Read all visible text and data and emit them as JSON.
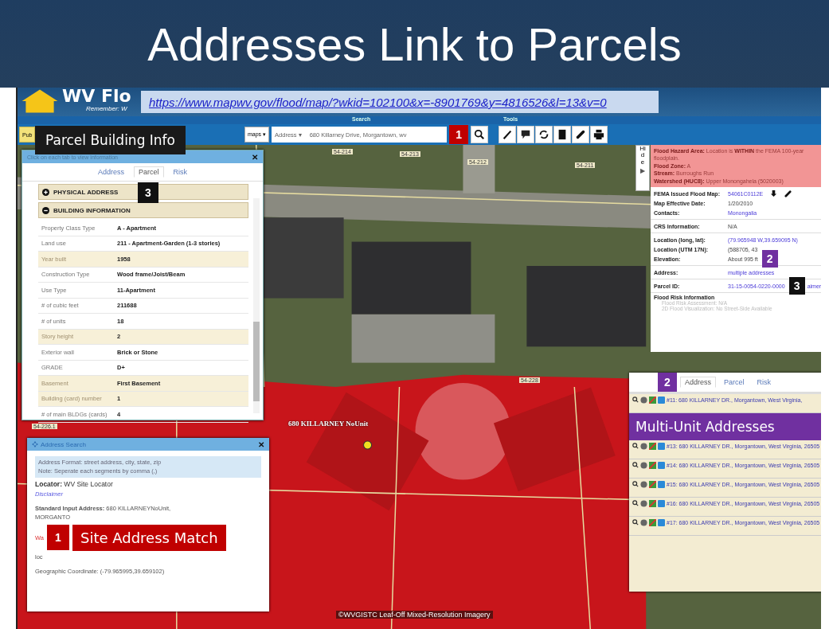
{
  "slide_title": "Addresses Link to Parcels",
  "url_callout": "https://www.mapwv.gov/flood/map/?wkid=102100&x=-8901769&y=4816526&l=13&v=0",
  "header": {
    "logo_text": "WV Flo",
    "tagline": "Remember: W"
  },
  "menu_labels": [
    "Search",
    "Tools"
  ],
  "toolbar": {
    "left_button": "Pub",
    "maps_button": "maps ▾",
    "search_type": "Address ▾",
    "search_value": "680 Killarney Drive, Morgantown, wv",
    "badge": {
      "number": "1",
      "color": "#c00000"
    }
  },
  "map": {
    "labels": [
      {
        "text": "54-214"
      },
      {
        "text": "54-213"
      },
      {
        "text": "54-212"
      },
      {
        "text": "54-211"
      },
      {
        "text": "54-228"
      },
      {
        "text": "54-226.1"
      }
    ],
    "address_marker_label": "680 KILLARNEY NoUnit",
    "copyright": "©WVGISTC Leaf-Off Mixed-Resolution Imagery"
  },
  "parcel_callout": {
    "label": "Parcel Building Info",
    "color": "#1a1a1a"
  },
  "parcel_panel": {
    "hint": "Click on each tab to view information",
    "close_glyph": "✕",
    "tabs": [
      {
        "label": "Address",
        "selected": false
      },
      {
        "label": "Parcel",
        "selected": true
      },
      {
        "label": "Risk",
        "selected": false
      }
    ],
    "badge": {
      "number": "3",
      "color": "#111111"
    },
    "sections": [
      {
        "label": "PHYSICAL ADDRESS",
        "expanded": false
      },
      {
        "label": "BUILDING INFORMATION",
        "expanded": true
      }
    ],
    "rows": [
      {
        "label": "Property Class Type",
        "value": "A - Apartment",
        "highlighted": false
      },
      {
        "label": "Land use",
        "value": "211 - Apartment-Garden (1-3 stories)",
        "highlighted": false
      },
      {
        "label": "Year built",
        "value": "1958",
        "highlighted": true
      },
      {
        "label": "Construction Type",
        "value": "Wood frame/Joist/Beam",
        "highlighted": false
      },
      {
        "label": "Use Type",
        "value": "11-Apartment",
        "highlighted": false
      },
      {
        "label": "# of cubic feet",
        "value": "211688",
        "highlighted": false
      },
      {
        "label": "# of units",
        "value": "18",
        "highlighted": false
      },
      {
        "label": "Story height",
        "value": "2",
        "highlighted": true
      },
      {
        "label": "Exterior wall",
        "value": "Brick or Stone",
        "highlighted": false
      },
      {
        "label": "GRADE",
        "value": "D+",
        "highlighted": false
      },
      {
        "label": "Basement",
        "value": "First Basement",
        "highlighted": true
      },
      {
        "label": "Building (card) number",
        "value": "1",
        "highlighted": true
      },
      {
        "label": "# of main BLDGs (cards)",
        "value": "4",
        "highlighted": false
      }
    ]
  },
  "info_panel": {
    "hide_tab": "Hide",
    "expand_arrow": "▶",
    "hazard": [
      "**Flood Hazard Area:** Location is **WITHIN** the FEMA 100-year floodplain.",
      "**Flood Zone:** A",
      "**Stream:** Burroughs Run",
      "**Watershed (HUC8):** Upper Monongahela (5020003)"
    ],
    "groups": [
      [
        {
          "label": "FEMA Issued Flood Map:",
          "value": "54061C0112E",
          "link": true
        },
        {
          "label": "Map Effective Date:",
          "value": "1/20/2010",
          "link": false
        },
        {
          "label": "Contacts:",
          "value": "Monongalia",
          "link": true
        }
      ],
      [
        {
          "label": "CRS Information:",
          "value": "N/A",
          "link": false
        }
      ],
      [
        {
          "label": "Location (long, lat):",
          "value": "(79.965948 W,39.659095 N)",
          "link": true
        },
        {
          "label": "Location (UTM 17N):",
          "value": "(588705, 43",
          "link": false
        },
        {
          "label": "Elevation:",
          "value": "About 995 ft",
          "link": false
        }
      ],
      [
        {
          "label": "Address:",
          "value": "multiple addresses",
          "link": true
        }
      ],
      [
        {
          "label": "Parcel ID:",
          "value": "31-15-0054-0220-0000",
          "link": true
        }
      ]
    ],
    "badges": [
      {
        "number": "2",
        "color": "#7030a0"
      },
      {
        "number": "3",
        "color": "#111111"
      }
    ],
    "cut_link": "aimer",
    "risk_title": "Flood Risk Information",
    "risk_lines": [
      "Flood Risk Assessment: N/A",
      "2D Flood Visualization: No Street-Side Available"
    ]
  },
  "address_panel": {
    "badge": {
      "number": "2",
      "color": "#7030a0"
    },
    "tabs": [
      {
        "label": "Address",
        "selected": true
      },
      {
        "label": "Parcel",
        "selected": false
      },
      {
        "label": "Risk",
        "selected": false
      }
    ],
    "callout": {
      "label": "Multi-Unit Addresses",
      "color": "#7030a0"
    },
    "rows": [
      {
        "text": "#11: 680 KILLARNEY DR., Morgantown, West Virginia,"
      },
      {
        "text": "#13: 680 KILLARNEY DR., Morgantown, West Virginia, 26505"
      },
      {
        "text": "#14: 680 KILLARNEY DR., Morgantown, West Virginia, 26505"
      },
      {
        "text": "#15: 680 KILLARNEY DR., Morgantown, West Virginia, 26505"
      },
      {
        "text": "#16: 680 KILLARNEY DR., Morgantown, West Virginia, 26505"
      },
      {
        "text": "#17: 680 KILLARNEY DR., Morgantown, West Virginia, 26505"
      }
    ]
  },
  "search_panel": {
    "title": "Address Search",
    "close_glyph": "✕",
    "note": [
      "Address Format: street address, city, state, zip",
      "Note: Seperate each segments by comma (,)"
    ],
    "locator": "**Locator:** WV Site Locator",
    "disclaimer": "Disclaimer",
    "standard_input": "**Standard Input Address:** 680 KILLARNEYNoUnit, MORGANTO",
    "warning": "Wa",
    "warning_line2": "loc",
    "coordinate": "Geographic Coordinate: (-79.965995,39.659102)",
    "badge": {
      "number": "1",
      "color": "#c00000"
    },
    "callout": {
      "label": "Site Address Match",
      "color": "#c00000"
    }
  }
}
